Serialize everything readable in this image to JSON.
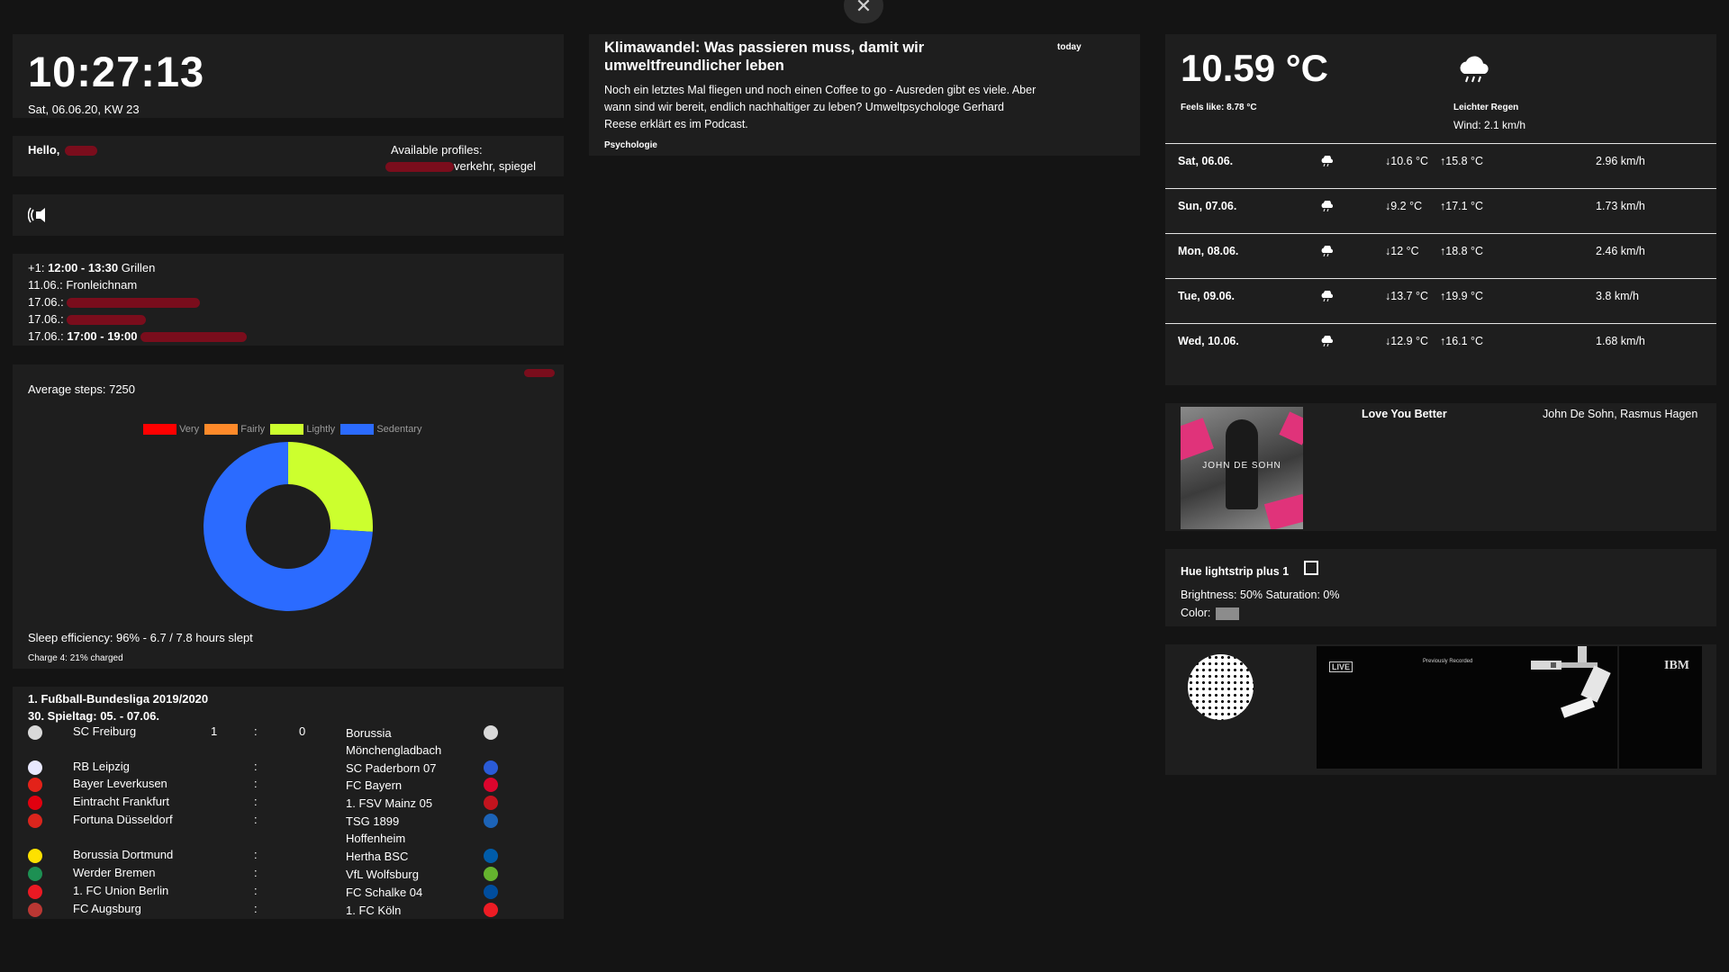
{
  "clock": {
    "time": "10:27:13",
    "date": "Sat, 06.06.20, KW 23"
  },
  "greeting": {
    "hello": "Hello,",
    "profiles_label": "Available profiles:",
    "profiles_value": "verkehr, spiegel"
  },
  "calendar": [
    {
      "prefix": "+1:",
      "time": "12:00 - 13:30",
      "title": "Grillen"
    },
    {
      "prefix": "11.06.:",
      "time": "",
      "title": "Fronleichnam"
    },
    {
      "prefix": "17.06.:",
      "time": "",
      "title": ""
    },
    {
      "prefix": "17.06.:",
      "time": "",
      "title": ""
    },
    {
      "prefix": "17.06.:",
      "time": "17:00 - 19:00",
      "title": ""
    }
  ],
  "fitbit": {
    "average_steps": "Average steps: 7250",
    "legend": [
      {
        "label": "Very",
        "color": "#ff0000"
      },
      {
        "label": "Fairly",
        "color": "#ff8a2a"
      },
      {
        "label": "Lightly",
        "color": "#ccff2e"
      },
      {
        "label": "Sedentary",
        "color": "#2b6bff"
      }
    ],
    "sleep": "Sleep efficiency: 96% - 6.7 / 7.8 hours slept",
    "charge": "Charge 4: 21% charged"
  },
  "chart_data": {
    "type": "pie",
    "categories": [
      "Very",
      "Fairly",
      "Lightly",
      "Sedentary"
    ],
    "values": [
      0,
      0,
      26,
      74
    ],
    "colors": [
      "#ff0000",
      "#ff8a2a",
      "#ccff2e",
      "#2b6bff"
    ],
    "legend_position": "top"
  },
  "liga": {
    "title": "1. Fußball-Bundesliga 2019/2020",
    "matchday": "30. Spieltag: 05. - 07.06.",
    "colon": ":",
    "matches": [
      {
        "home": "SC Freiburg",
        "hs": "1",
        "as": "0",
        "away": "Borussia",
        "away2": "Mönchengladbach",
        "hc": "#d9d9d9",
        "ac": "#d9d9d9"
      },
      {
        "home": "RB Leipzig",
        "hs": "",
        "as": "",
        "away": "SC Paderborn 07",
        "away2": "",
        "hc": "#e8e8ff",
        "ac": "#2a5bd7"
      },
      {
        "home": "Bayer Leverkusen",
        "hs": "",
        "as": "",
        "away": "FC Bayern",
        "away2": "",
        "hc": "#e32219",
        "ac": "#dc052d"
      },
      {
        "home": "Eintracht Frankfurt",
        "hs": "",
        "as": "",
        "away": "1. FSV Mainz 05",
        "away2": "",
        "hc": "#e1000f",
        "ac": "#c3141e"
      },
      {
        "home": "Fortuna Düsseldorf",
        "hs": "",
        "as": "",
        "away": "TSG 1899",
        "away2": "Hoffenheim",
        "hc": "#da251d",
        "ac": "#1c63b7"
      },
      {
        "home": "Borussia Dortmund",
        "hs": "",
        "as": "",
        "away": "Hertha BSC",
        "away2": "",
        "hc": "#fde100",
        "ac": "#005ca9"
      },
      {
        "home": "Werder Bremen",
        "hs": "",
        "as": "",
        "away": "VfL Wolfsburg",
        "away2": "",
        "hc": "#1d9053",
        "ac": "#65b32e"
      },
      {
        "home": "1. FC Union Berlin",
        "hs": "",
        "as": "",
        "away": "FC Schalke 04",
        "away2": "",
        "hc": "#eb1923",
        "ac": "#004d9d"
      },
      {
        "home": "FC Augsburg",
        "hs": "",
        "as": "",
        "away": "1. FC Köln",
        "away2": "",
        "hc": "#ba3733",
        "ac": "#ed1c24"
      }
    ]
  },
  "news": {
    "title": "Klimawandel: Was passieren muss, damit wir umweltfreundlicher leben",
    "time": "today",
    "body": "Noch ein letztes Mal fliegen und noch einen Coffee to go - Ausreden gibt es viele. Aber wann sind wir bereit, endlich nachhaltiger zu leben? Umweltpsychologe Gerhard Reese erklärt es im Podcast.",
    "source": "Psychologie"
  },
  "weather": {
    "temp": "10.59 °C",
    "feels": "Feels like: 8.78 °C",
    "desc": "Leichter Regen",
    "wind": "Wind: 2.1 km/h",
    "forecast": [
      {
        "day": "Sat, 06.06.",
        "low": "↓10.6 °C",
        "high": "↑15.8 °C",
        "wind": "2.96 km/h"
      },
      {
        "day": "Sun, 07.06.",
        "low": "↓9.2 °C",
        "high": "↑17.1 °C",
        "wind": "1.73 km/h"
      },
      {
        "day": "Mon, 08.06.",
        "low": "↓12 °C",
        "high": "↑18.8 °C",
        "wind": "2.46 km/h"
      },
      {
        "day": "Tue, 09.06.",
        "low": "↓13.7 °C",
        "high": "↑19.9 °C",
        "wind": "3.8 km/h"
      },
      {
        "day": "Wed, 10.06.",
        "low": "↓12.9 °C",
        "high": "↑16.1 °C",
        "wind": "1.68 km/h"
      }
    ]
  },
  "music": {
    "title": "Love You Better",
    "artist": "John De Sohn, Rasmus Hagen",
    "cover_text": "JOHN DE SOHN"
  },
  "hue": {
    "name": "Hue lightstrip plus 1",
    "values": "Brightness: 50% Saturation: 0%",
    "color_label": "Color:",
    "swatch": "#8c8c8c"
  },
  "space": {
    "live": "LIVE",
    "recorded": "Previously Recorded",
    "ibm": "IBM"
  }
}
